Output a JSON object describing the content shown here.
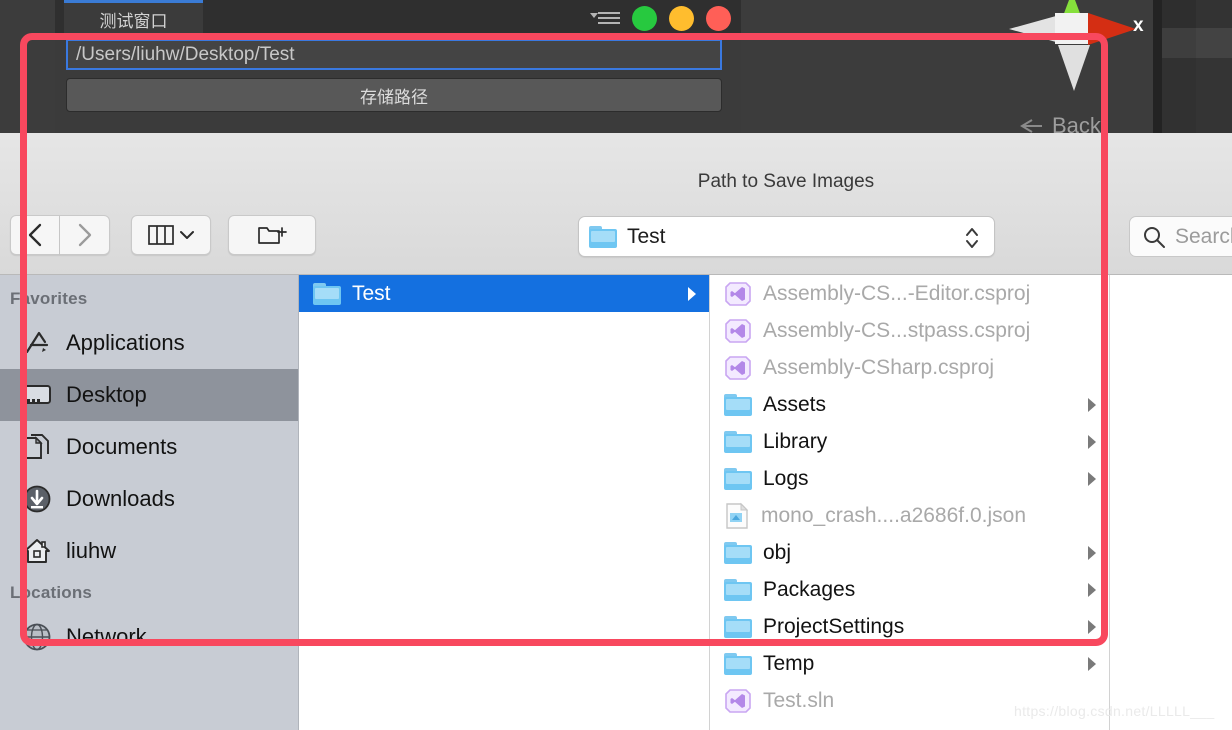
{
  "unity_window": {
    "tab_label": "测试窗口",
    "path_input_value": "/Users/liuhw/Desktop/Test",
    "save_button_label": "存储路径",
    "window_controls": [
      "menu-icon",
      "minimize-green-dot",
      "maximize-yellow-dot",
      "close-red-dot"
    ]
  },
  "scene_gizmo": {
    "x_axis_label": "x",
    "back_label": "Back"
  },
  "dialog": {
    "title": "Path to Save Images",
    "toolbar": {
      "back_icon": "chevron-left-icon",
      "forward_icon": "chevron-right-icon",
      "view_icon": "column-view-icon",
      "view_chevron": "chevron-down-icon",
      "new_folder_icon": "new-folder-icon"
    },
    "path_popup": {
      "icon": "folder-icon",
      "value": "Test",
      "stepper_icon": "up-down-stepper-icon"
    },
    "search": {
      "icon": "search-icon",
      "placeholder": "Search"
    },
    "sidebar": {
      "sections": [
        {
          "heading": "Favorites",
          "items": [
            {
              "label": "Applications",
              "icon": "applications-icon",
              "selected": false
            },
            {
              "label": "Desktop",
              "icon": "desktop-icon",
              "selected": true
            },
            {
              "label": "Documents",
              "icon": "documents-icon",
              "selected": false
            },
            {
              "label": "Downloads",
              "icon": "downloads-icon",
              "selected": false
            },
            {
              "label": "liuhw",
              "icon": "home-icon",
              "selected": false
            }
          ]
        },
        {
          "heading": "Locations",
          "items": [
            {
              "label": "Network",
              "icon": "network-globe-icon",
              "selected": false
            }
          ]
        }
      ]
    },
    "column_middle": [
      {
        "label": "Test",
        "icon": "folder-icon",
        "selected": true,
        "has_chevron": true,
        "dim": false
      }
    ],
    "column_right": [
      {
        "label": "Assembly-CS...-Editor.csproj",
        "icon": "visual-studio-icon",
        "dim": true,
        "has_chevron": false
      },
      {
        "label": "Assembly-CS...stpass.csproj",
        "icon": "visual-studio-icon",
        "dim": true,
        "has_chevron": false
      },
      {
        "label": "Assembly-CSharp.csproj",
        "icon": "visual-studio-icon",
        "dim": true,
        "has_chevron": false
      },
      {
        "label": "Assets",
        "icon": "folder-icon",
        "dim": false,
        "has_chevron": true
      },
      {
        "label": "Library",
        "icon": "folder-icon",
        "dim": false,
        "has_chevron": true
      },
      {
        "label": "Logs",
        "icon": "folder-icon",
        "dim": false,
        "has_chevron": true
      },
      {
        "label": "mono_crash....a2686f.0.json",
        "icon": "json-file-icon",
        "dim": true,
        "has_chevron": false
      },
      {
        "label": "obj",
        "icon": "folder-icon",
        "dim": false,
        "has_chevron": true
      },
      {
        "label": "Packages",
        "icon": "folder-icon",
        "dim": false,
        "has_chevron": true
      },
      {
        "label": "ProjectSettings",
        "icon": "folder-icon",
        "dim": false,
        "has_chevron": true
      },
      {
        "label": "Temp",
        "icon": "folder-icon",
        "dim": false,
        "has_chevron": true
      },
      {
        "label": "Test.sln",
        "icon": "visual-studio-icon",
        "dim": true,
        "has_chevron": false
      }
    ]
  },
  "watermark": "https://blog.csdn.net/LLLLL___",
  "colors": {
    "selection_blue": "#1470e0",
    "annotation_red": "#f8485e",
    "sidebar_bg": "#c8ccd4",
    "sidebar_selected": "#8e939c",
    "folder_blue": "#6ec6f2",
    "unity_bg": "#3b3b3b",
    "gizmo_x_red": "#d42e13",
    "gizmo_y_green": "#86e03c"
  }
}
